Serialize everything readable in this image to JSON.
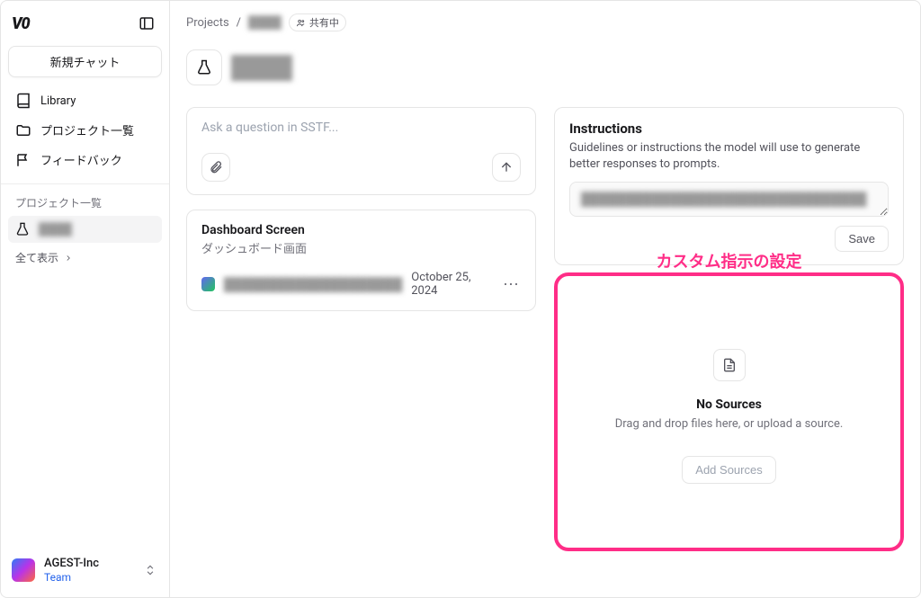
{
  "sidebar": {
    "logo": "V0",
    "new_chat": "新規チャット",
    "nav": [
      {
        "label": "Library",
        "icon": "library"
      },
      {
        "label": "プロジェクト一覧",
        "icon": "folder"
      },
      {
        "label": "フィードバック",
        "icon": "flag"
      }
    ],
    "section_label": "プロジェクト一覧",
    "project_item": "████",
    "show_all": "全て表示",
    "team": {
      "name": "AGEST-Inc",
      "role": "Team"
    }
  },
  "breadcrumbs": {
    "root": "Projects",
    "sep": "/",
    "current": "████",
    "share": "共有中"
  },
  "project": {
    "title": "████"
  },
  "ask": {
    "placeholder": "Ask a question in SSTF..."
  },
  "dashboard": {
    "title": "Dashboard Screen",
    "subtitle": "ダッシュボード画面",
    "line": "████████████████████",
    "date": "October 25, 2024"
  },
  "instructions": {
    "title": "Instructions",
    "desc": "Guidelines or instructions the model will use to generate better responses to prompts.",
    "value": "████████████████████████████████",
    "save": "Save"
  },
  "annotation": "カスタム指示の設定",
  "sources": {
    "empty_title": "No Sources",
    "empty_desc": "Drag and drop files here, or upload a source.",
    "add": "Add Sources"
  }
}
